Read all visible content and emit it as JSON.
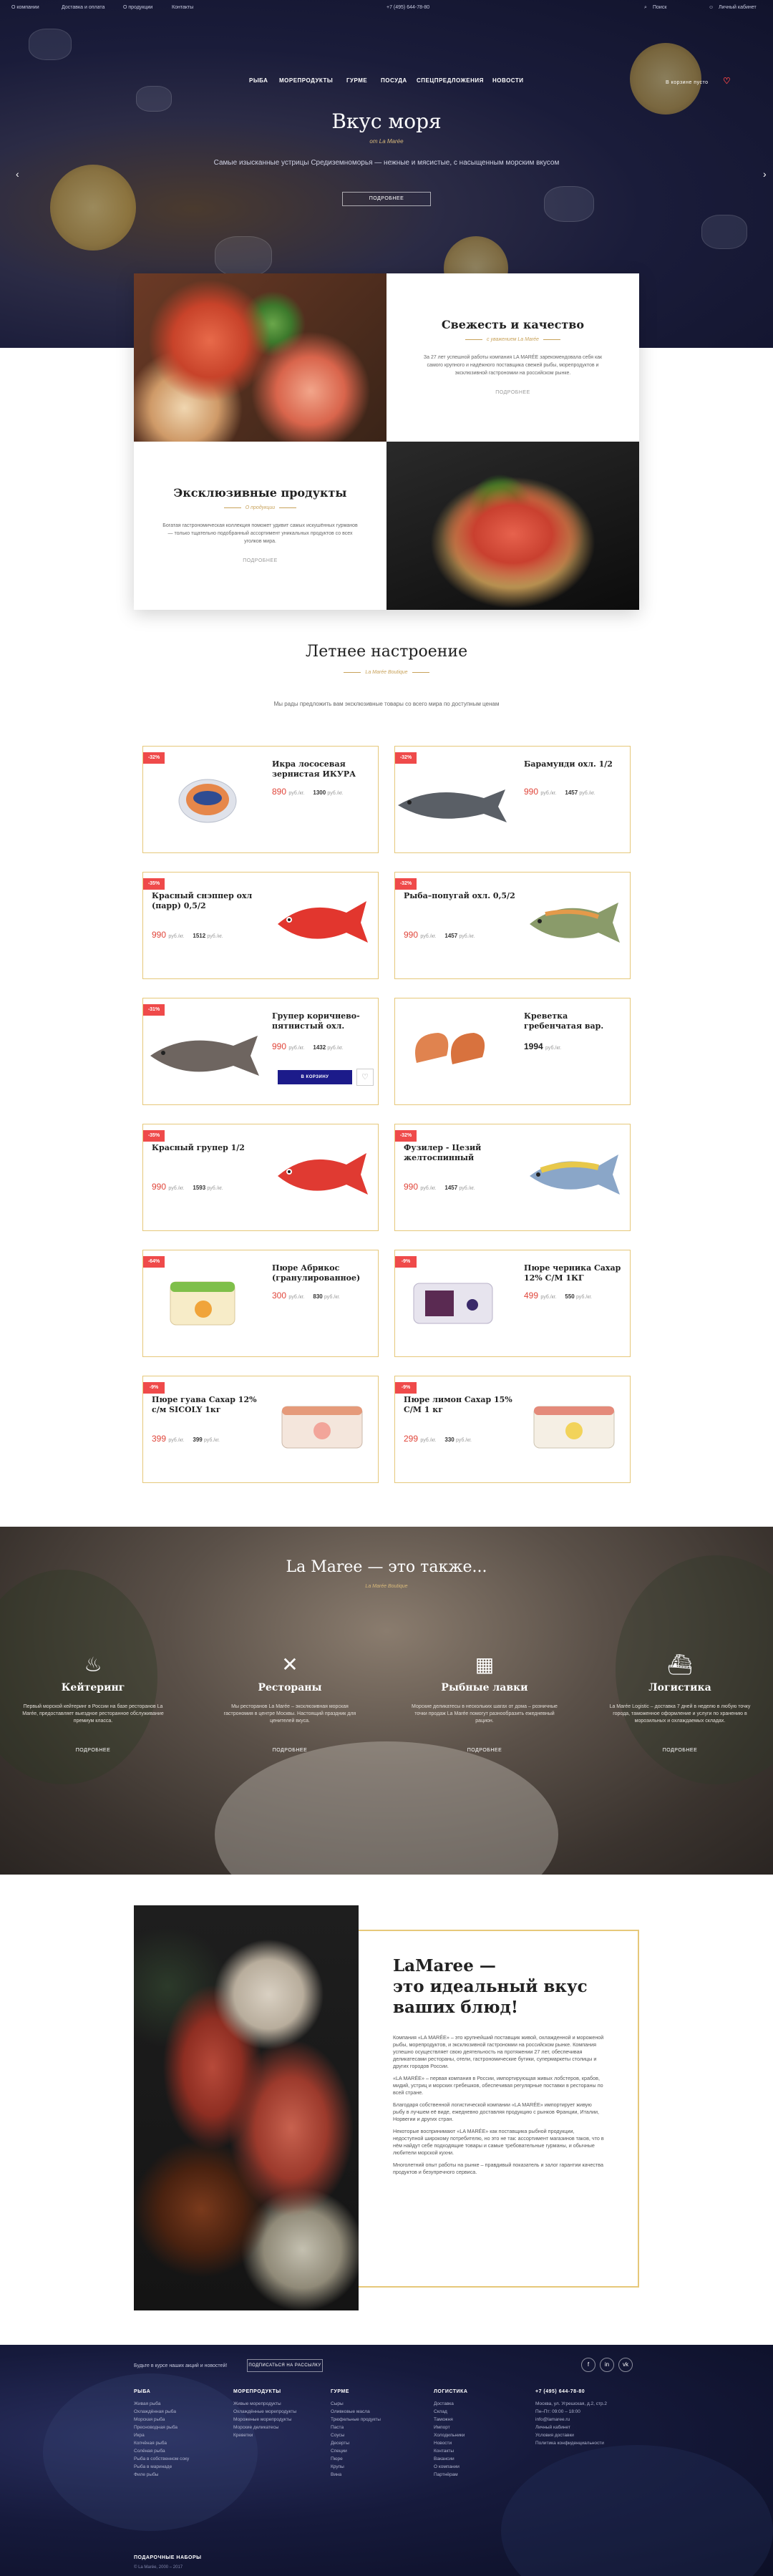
{
  "topbar": {
    "items": [
      "О компании",
      "Доставка и оплата",
      "О продукции",
      "Контакты"
    ],
    "phone": "+7 (495) 644-78-80",
    "search": "Поиск",
    "personal": "Личный кабинет"
  },
  "nav": {
    "items": [
      "РЫБА",
      "МОРЕПРОДУКТЫ",
      "ГУРМЕ",
      "ПОСУДА",
      "СПЕЦПРЕДЛОЖЕНИЯ",
      "НОВОСТИ"
    ],
    "cart": "В корзине пусто"
  },
  "hero": {
    "title": "Вкус моря",
    "sub": "от La Marée",
    "desc": "Самые изысканные устрицы Средиземноморья — нежные и мясистые, с насыщенным морским вкусом",
    "button": "ПОДРОБНЕЕ"
  },
  "info": {
    "fresh": {
      "title": "Свежесть и качество",
      "sub": "с уважением La Marée",
      "text": "За 27 лет успешной работы компания LA MARÉE зарекомендовала себя как самого крупного и надёжного поставщика свежей рыбы, морепродуктов и эксклюзивной гастрономии на российском рынке.",
      "more": "ПОДРОБНЕЕ"
    },
    "exclusive": {
      "title": "Эксклюзивные продукты",
      "sub": "О продукции",
      "text": "Богатая гастрономическая коллекция поможет удивит самых искушённых гурманов — только тщательно подобранный ассортимент уникальных продуктов со всех уголков мира.",
      "more": "ПОДРОБНЕЕ"
    }
  },
  "summer": {
    "title": "Летнее настроение",
    "sub": "La Marée Boutique",
    "desc": "Мы рады предложить вам эксклюзивные товары со всего мира по доступным ценам"
  },
  "products": [
    {
      "disc": "-32%",
      "name": "Икра лососевая зернистая ИКУРА",
      "price": "890",
      "unit": "руб./кг.",
      "old": "1300",
      "old_unit": "руб./кг."
    },
    {
      "disc": "-32%",
      "name": "Барамунди охл. 1/2",
      "price": "990",
      "unit": "руб./кг.",
      "old": "1457",
      "old_unit": "руб./кг."
    },
    {
      "disc": "-35%",
      "name": "Красный снэппер охл (парр) 0,5/2",
      "price": "990",
      "unit": "руб./кг.",
      "old": "1512",
      "old_unit": "руб./кг."
    },
    {
      "disc": "-32%",
      "name": "Рыба–попугай охл. 0,5/2",
      "price": "990",
      "unit": "руб./кг.",
      "old": "1457",
      "old_unit": "руб./кг."
    },
    {
      "disc": "-31%",
      "name": "Групер коричнево-пятнистый охл.",
      "price": "990",
      "unit": "руб./кг.",
      "old": "1432",
      "old_unit": "руб./кг."
    },
    {
      "disc": "",
      "name": "Креветка гребенчатая вар.",
      "price": "1994",
      "unit": "руб./кг.",
      "old": "",
      "old_unit": ""
    },
    {
      "disc": "-35%",
      "name": "Красный групер 1/2",
      "price": "990",
      "unit": "руб./кг.",
      "old": "1593",
      "old_unit": "руб./кг."
    },
    {
      "disc": "-32%",
      "name": "Фузилер - Цезий желтоспинный",
      "price": "990",
      "unit": "руб./кг.",
      "old": "1457",
      "old_unit": "руб./кг."
    },
    {
      "disc": "-64%",
      "name": "Пюре Абрикос (гранулированное)",
      "price": "300",
      "unit": "руб./кг.",
      "old": "830",
      "old_unit": "руб./кг."
    },
    {
      "disc": "-9%",
      "name": "Пюре черника Сахар 12% С/М 1КГ",
      "price": "499",
      "unit": "руб./кг.",
      "old": "550",
      "old_unit": "руб./кг."
    },
    {
      "disc": "-9%",
      "name": "Пюре гуава Сахар 12% с/м SICOLY 1кг",
      "price": "399",
      "unit": "руб./кг.",
      "old": "399",
      "old_unit": "руб./кг."
    },
    {
      "disc": "-9%",
      "name": "Пюре лимон Сахар 15% С/М 1 кг",
      "price": "299",
      "unit": "руб./кг.",
      "old": "330",
      "old_unit": "руб./кг."
    }
  ],
  "cart_btn": "В КОРЗИНУ",
  "also": {
    "title": "La Maree — это также...",
    "sub": "La Marée Boutique",
    "services": [
      {
        "title": "Кейтеринг",
        "text": "Первый морской кейтеринг в России на базе ресторанов La Marée, предоставляет выездное ресторанное обслуживание премиум класса.",
        "more": "ПОДРОБНЕЕ"
      },
      {
        "title": "Рестораны",
        "text": "Мы ресторанов La Marée – эксклюзивная морская гастрономия в центре Москвы. Настоящий праздник для ценителей вкуса.",
        "more": "ПОДРОБНЕЕ"
      },
      {
        "title": "Рыбные лавки",
        "text": "Морские деликатесы в нескольких шагах от дома – розничные точки продаж La Marée помогут разнообразить ежедневный рацион.",
        "more": "ПОДРОБНЕЕ"
      },
      {
        "title": "Логистика",
        "text": "La Marée Logistic – доставка 7 дней в неделю в любую точку города, таможенное оформление и услуги по хранению в морозильных и охлаждаемых складах.",
        "more": "ПОДРОБНЕЕ"
      }
    ]
  },
  "ideal": {
    "title_lines": [
      "LaMaree —",
      "это идеальный вкус",
      "ваших блюд!"
    ],
    "paragraphs": [
      "Компания «LA MARÉE» – это крупнейший поставщик живой, охлажденной и мороженой рыбы, морепродуктов, и эксклюзивной гастрономии на российском рынке. Компания успешно осуществляет свою деятельность на протяжении 27 лет, обеспечивая деликатесами рестораны, отели, гастрономические бутики, супермаркеты столицы и других городов России.",
      "«LA MARÉE» – первая компания в России, импортирующая живых лобстеров, крабов, мидий, устриц и морских гребешков, обеспечивая регулярные поставки в рестораны по всей стране.",
      "Благодаря собственной логистической компании «LA MARÉE» импортирует живую рыбу в лучшем её виде, ежедневно доставляя продукцию с рынков Франции, Италии, Норвегии и других стран.",
      "Некоторые воспринимают «LA MARÉE» как поставщика рыбной продукции, недоступной широкому потребителю, но это не так: ассортимент магазинов таков, что в нём найдут себе подходящие товары и самые требовательные гурманы, и обычные любители морской кухни.",
      "Многолетний опыт работы на рынке – правдивый показатель и залог гарантии качества продуктов и безупречного сервиса."
    ]
  },
  "footer": {
    "subscribe": "Будьте в курсе наших акций и новостей!",
    "subscribe_btn": "ПОДПИСАТЬСЯ НА РАССЫЛКУ",
    "social": [
      "f",
      "in",
      "vk"
    ],
    "cols": [
      {
        "title": "РЫБА",
        "items": [
          "Живая рыба",
          "Охлаждённая рыба",
          "Морская рыба",
          "Пресноводная рыба",
          "Икра",
          "Копчёная рыба",
          "Солёная рыба",
          "Рыба в собственном соку",
          "Рыба в маринаде",
          "Филе рыбы"
        ]
      },
      {
        "title": "МОРЕПРОДУКТЫ",
        "items": [
          "Живые морепродукты",
          "Охлаждённые морепродукты",
          "Мороженые морепродукты",
          "Морские деликатесы",
          "Креветки"
        ]
      },
      {
        "title": "ГУРМЕ",
        "items": [
          "Сыры",
          "Оливковые масла",
          "Трюфельные продукты",
          "Паста",
          "Соусы",
          "Десерты",
          "Специи",
          "Пюре",
          "Крупы",
          "Вина"
        ]
      },
      {
        "title": "ЛОГИСТИКА",
        "items": [
          "Доставка",
          "Склад",
          "Таможня",
          "Импорт",
          "Холодильники",
          "Новости",
          "Контакты",
          "Вакансии",
          "О компании",
          "Партнёрам"
        ]
      },
      {
        "title": "+7 (495) 644-78-80",
        "items": [
          "Москва, ул. Угрешская, д.2, стр.2",
          "Пн–Пт: 09:00 – 18:00",
          "info@lamaree.ru",
          "Личный кабинет",
          "Условия доставки",
          "Политика конфиденциальности"
        ]
      }
    ],
    "bottom_title": "ПОДАРОЧНЫЕ НАБОРЫ",
    "copyright": "© La Marée, 2000 – 2017"
  }
}
